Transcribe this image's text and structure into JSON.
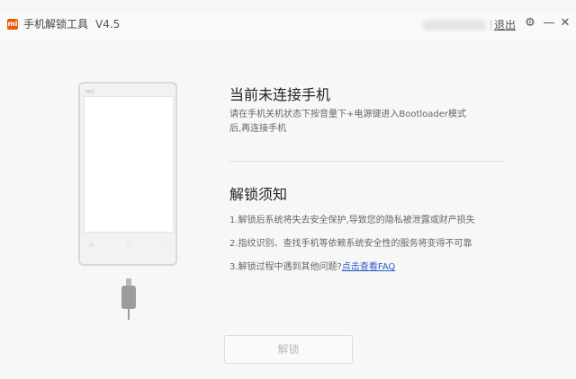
{
  "app": {
    "logo_text": "mi",
    "title": "手机解锁工具",
    "version": "V4.5"
  },
  "titlebar": {
    "logout_label": "退出",
    "icons": [
      "gear-icon",
      "minimize-icon",
      "close-icon"
    ],
    "gear_glyph": "⚙",
    "minimize_glyph": "—",
    "close_glyph": "✕"
  },
  "phone": {
    "brand": "mi",
    "keys": [
      "≡",
      "○",
      "‹"
    ]
  },
  "connect": {
    "heading": "当前未连接手机",
    "line1": "请在手机关机状态下按音量下+电源键进入Bootloader模式",
    "line2": "后,再连接手机"
  },
  "notice": {
    "heading": "解锁须知",
    "item1": "1.解锁后系统将失去安全保护,导致您的隐私被泄露或财产损失",
    "item2": "2.指纹识别、查找手机等依赖系统安全性的服务将变得不可靠",
    "item3_prefix": "3.解锁过程中遇到其他问题?",
    "item3_link": "点击查看FAQ"
  },
  "actions": {
    "unlock_label": "解锁"
  },
  "colors": {
    "brand": "#e85a0f",
    "link": "#2b5fc4"
  }
}
